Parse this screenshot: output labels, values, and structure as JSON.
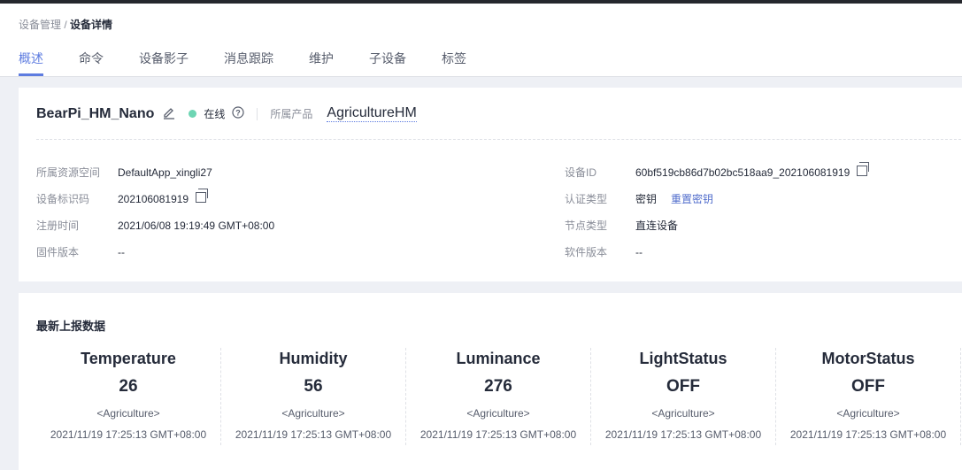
{
  "breadcrumb": {
    "parent": "设备管理",
    "separator": " / ",
    "current": "设备详情"
  },
  "tabs": [
    "概述",
    "命令",
    "设备影子",
    "消息跟踪",
    "维护",
    "子设备",
    "标签"
  ],
  "device": {
    "name": "BearPi_HM_Nano",
    "status": "在线",
    "product_label": "所属产品",
    "product": "AgricultureHM"
  },
  "left_fields": [
    {
      "label": "所属资源空间",
      "value": "DefaultApp_xingli27"
    },
    {
      "label": "设备标识码",
      "value": "202106081919"
    },
    {
      "label": "注册时间",
      "value": "2021/06/08 19:19:49 GMT+08:00"
    },
    {
      "label": "固件版本",
      "value": "--"
    }
  ],
  "right_fields": [
    {
      "label": "设备ID",
      "value": "60bf519cb86d7b02bc518aa9_202106081919"
    },
    {
      "label": "认证类型",
      "value": "密钥",
      "link": "重置密钥"
    },
    {
      "label": "节点类型",
      "value": "直连设备"
    },
    {
      "label": "软件版本",
      "value": "--"
    }
  ],
  "latest": {
    "title": "最新上报数据",
    "items": [
      {
        "name": "Temperature",
        "value": "26",
        "service": "<Agriculture>",
        "time": "2021/11/19 17:25:13 GMT+08:00"
      },
      {
        "name": "Humidity",
        "value": "56",
        "service": "<Agriculture>",
        "time": "2021/11/19 17:25:13 GMT+08:00"
      },
      {
        "name": "Luminance",
        "value": "276",
        "service": "<Agriculture>",
        "time": "2021/11/19 17:25:13 GMT+08:00"
      },
      {
        "name": "LightStatus",
        "value": "OFF",
        "service": "<Agriculture>",
        "time": "2021/11/19 17:25:13 GMT+08:00"
      },
      {
        "name": "MotorStatus",
        "value": "OFF",
        "service": "<Agriculture>",
        "time": "2021/11/19 17:25:13 GMT+08:00"
      }
    ]
  }
}
